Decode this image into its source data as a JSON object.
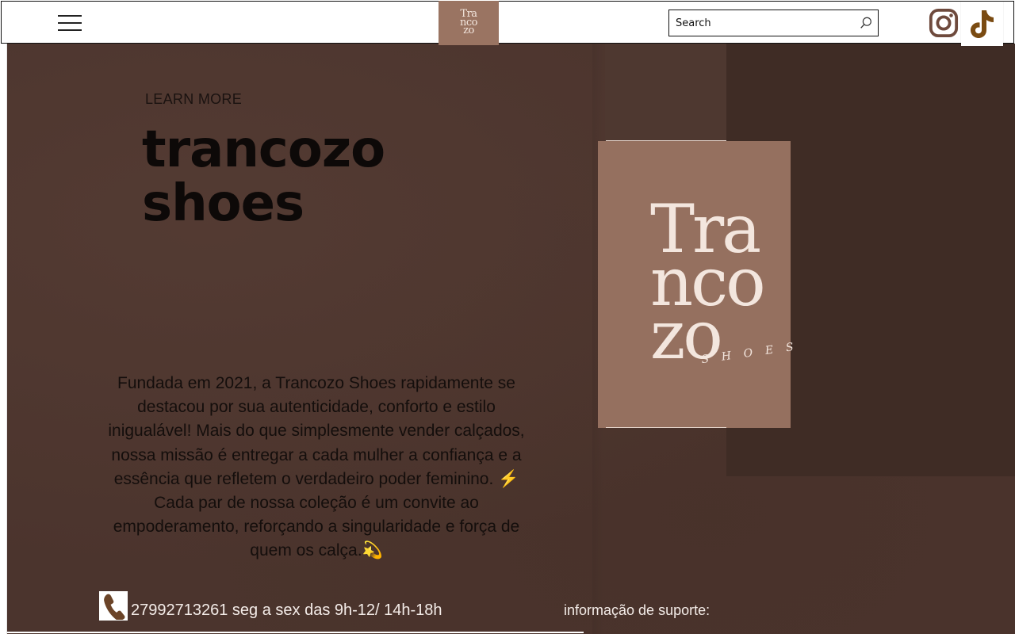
{
  "header": {
    "menu_icon": "hamburger-menu-icon",
    "logo_text_lines": [
      "Tra",
      "nco",
      "zo"
    ],
    "search": {
      "placeholder": "Search",
      "value": "",
      "icon": "search-icon"
    },
    "social": {
      "instagram_icon": "instagram-icon",
      "tiktok_icon": "tiktok-icon"
    }
  },
  "hero": {
    "learn_more": "LEARN MORE",
    "title_line1": "trancozo",
    "title_line2": "shoes",
    "about": "Fundada em 2021, a Trancozo Shoes rapidamente se destacou por sua autenticidade, conforto e estilo inigualável! Mais do que simplesmente vender calçados, nossa missão é entregar a cada mulher a confiança e a essência que refletem o verdadeiro poder feminino. ⚡ Cada par de nossa coleção é um convite ao empoderamento, reforçando a singularidade e força de quem os calça.💫",
    "logo_card": {
      "text_lines": [
        "Tra",
        "nco",
        "zo"
      ],
      "subtext": "SHOES"
    }
  },
  "footer": {
    "phone_icon": "phone-icon",
    "contact": "27992713261 seg a sex das 9h-12/ 14h-18h",
    "support": "informação de suporte:"
  },
  "colors": {
    "hero_bg": "#4b342d",
    "logo_bg": "#9a7462",
    "tiktok_brand": "#7a4b12",
    "instagram_brand": "#6e4a3d"
  }
}
